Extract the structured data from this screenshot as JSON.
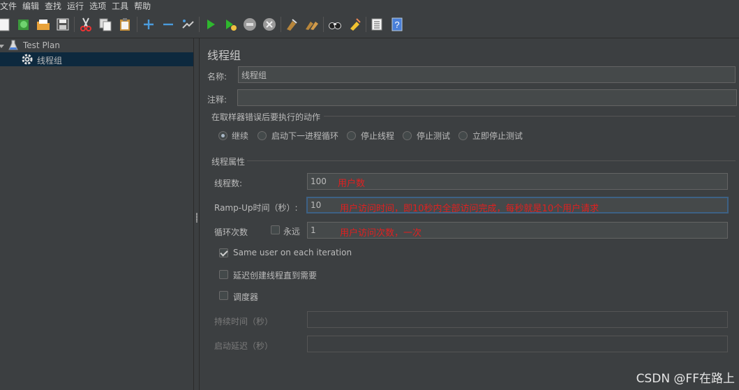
{
  "menu": [
    "文件",
    "编辑",
    "查找",
    "运行",
    "选项",
    "工具",
    "帮助"
  ],
  "toolbar_icons": [
    "new-icon",
    "templates-icon",
    "open-icon",
    "save-icon",
    "cut-icon",
    "copy-icon",
    "paste-icon",
    "expand-icon",
    "collapse-icon",
    "toggle-icon",
    "start-icon",
    "start-no-pause-icon",
    "stop-icon",
    "shutdown-icon",
    "clear-icon",
    "clear-all-icon",
    "search-icon",
    "reset-search-icon",
    "function-helper-icon",
    "help-icon"
  ],
  "tree": {
    "test_plan": "Test Plan",
    "thread_group": "线程组"
  },
  "panel": {
    "title": "线程组",
    "name_label": "名称:",
    "name_value": "线程组",
    "comment_label": "注释:",
    "comment_value": "",
    "error_action": {
      "title": "在取样器错误后要执行的动作",
      "options": [
        "继续",
        "启动下一进程循环",
        "停止线程",
        "停止测试",
        "立即停止测试"
      ],
      "selected": "继续"
    },
    "thread_props": {
      "title": "线程属性",
      "threads_label": "线程数:",
      "threads_value": "100",
      "threads_note": "用户数",
      "rampup_label": "Ramp-Up时间（秒）:",
      "rampup_value": "10",
      "rampup_note": "用户访问时间，即10秒内全部访问完成，每秒就是10个用户请求",
      "loop_label": "循环次数",
      "forever_label": "永远",
      "forever_checked": false,
      "loop_value": "1",
      "loop_note": "用户访问次数，一次",
      "same_user_label": "Same user on each iteration",
      "same_user_checked": true,
      "delay_label": "延迟创建线程直到需要",
      "delay_checked": false,
      "scheduler_label": "调度器",
      "scheduler_checked": false,
      "duration_label": "持续时间（秒）",
      "duration_value": "",
      "startup_delay_label": "启动延迟（秒）",
      "startup_delay_value": ""
    }
  },
  "watermark": "CSDN @FF在路上",
  "colors": {
    "background": "#3c3f41",
    "selection": "#0d293e",
    "annotation": "#e02020",
    "focus_border": "#3d6185"
  }
}
